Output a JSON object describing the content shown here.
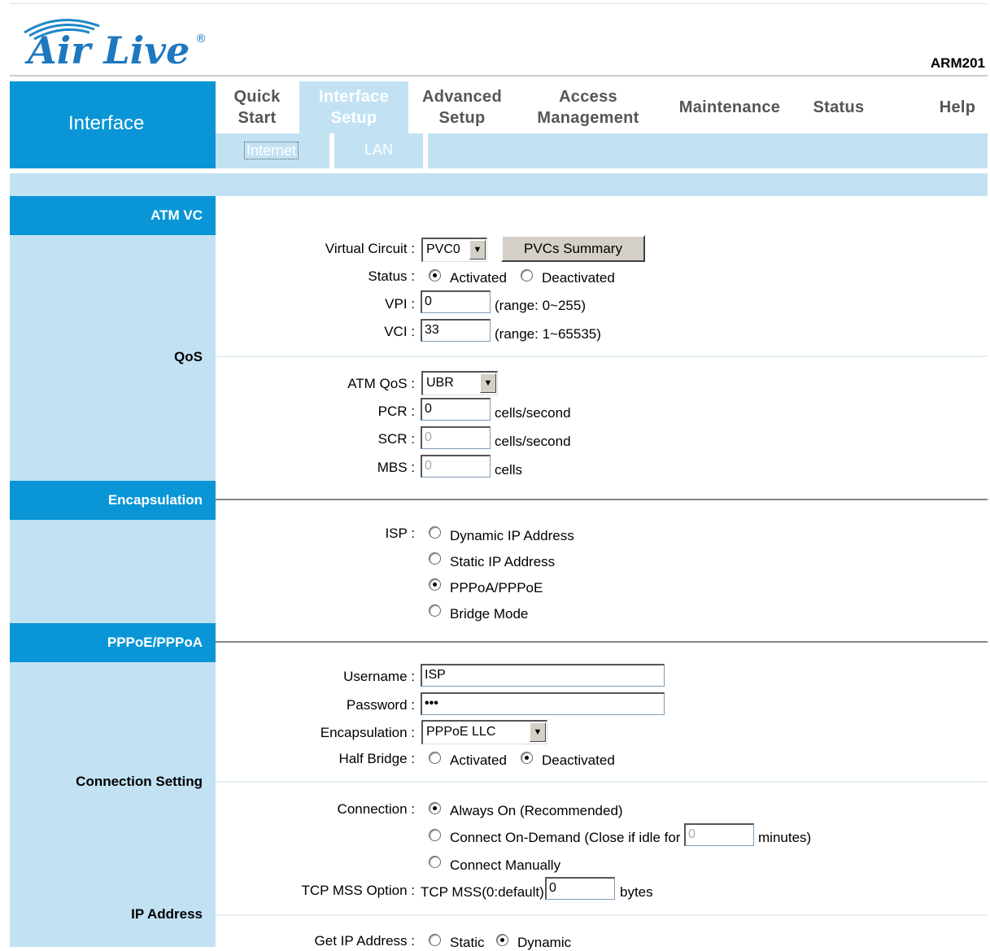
{
  "brand": {
    "model": "ARM201"
  },
  "sidebar": {
    "title": "Interface"
  },
  "nav": {
    "tabs": [
      {
        "label": "Quick\nStart"
      },
      {
        "label": "Interface\nSetup"
      },
      {
        "label": "Advanced\nSetup"
      },
      {
        "label": "Access\nManagement"
      },
      {
        "label": "Maintenance"
      },
      {
        "label": "Status"
      },
      {
        "label": "Help"
      }
    ],
    "subtabs": [
      {
        "label": "Internet"
      },
      {
        "label": "LAN"
      }
    ]
  },
  "sections": {
    "atm_vc": "ATM VC",
    "qos": "QoS",
    "encapsulation": "Encapsulation",
    "pppoe": "PPPoE/PPPoA",
    "connection_setting": "Connection Setting",
    "ip_address": "IP Address"
  },
  "atm": {
    "vc_label": "Virtual Circuit :",
    "vc_value": "PVC0",
    "pvcs_button": "PVCs Summary",
    "status_label": "Status :",
    "activated": "Activated",
    "deactivated": "Deactivated",
    "vpi_label": "VPI :",
    "vpi_value": "0",
    "vpi_range": "(range: 0~255)",
    "vci_label": "VCI :",
    "vci_value": "33",
    "vci_range": "(range: 1~65535)"
  },
  "qos": {
    "atm_qos_label": "ATM QoS :",
    "atm_qos_value": "UBR",
    "pcr_label": "PCR :",
    "pcr_value": "0",
    "scr_label": "SCR :",
    "scr_value": "0",
    "mbs_label": "MBS :",
    "mbs_value": "0",
    "cells_per_second": "cells/second",
    "cells": "cells"
  },
  "isp": {
    "label": "ISP :",
    "options": [
      "Dynamic IP Address",
      "Static IP Address",
      "PPPoA/PPPoE",
      "Bridge Mode"
    ],
    "selected": "PPPoA/PPPoE"
  },
  "pppoe": {
    "username_label": "Username :",
    "username_value": "ISP",
    "password_label": "Password :",
    "password_value": "•••",
    "encap_label": "Encapsulation :",
    "encap_value": "PPPoE LLC",
    "half_bridge_label": "Half Bridge :",
    "activated": "Activated",
    "deactivated": "Deactivated"
  },
  "connection": {
    "label": "Connection :",
    "always_on": "Always On (Recommended)",
    "on_demand": "Connect On-Demand (Close if idle for",
    "idle_value": "0",
    "minutes": "minutes)",
    "manually": "Connect Manually",
    "tcp_mss_label": "TCP MSS Option :",
    "tcp_mss_text": "TCP MSS(0:default)",
    "tcp_mss_value": "0",
    "bytes": "bytes"
  },
  "ip": {
    "get_ip_label": "Get IP Address :",
    "static": "Static",
    "dynamic": "Dynamic"
  },
  "colors": {
    "accent": "#0a96d6",
    "light": "#c2e2f4"
  }
}
